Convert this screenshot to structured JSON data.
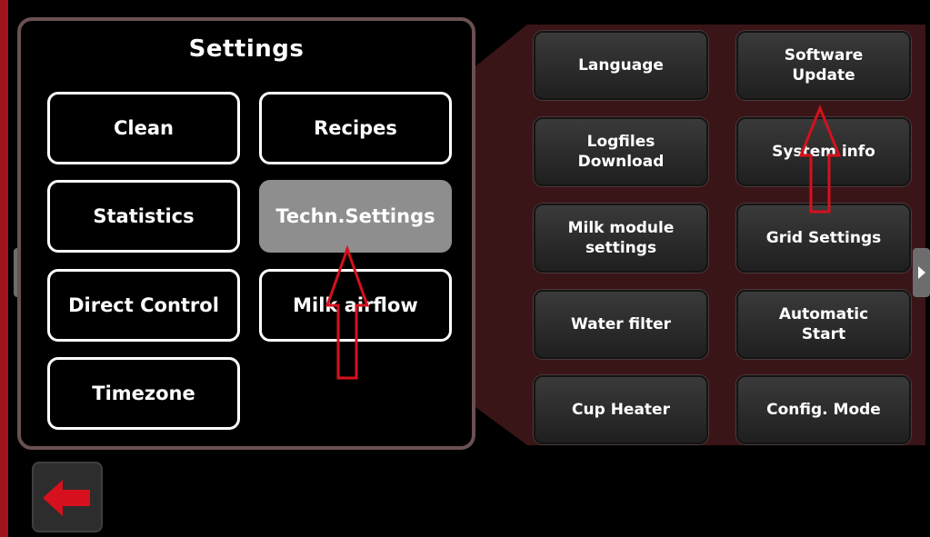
{
  "settings_panel": {
    "title": "Settings",
    "buttons": [
      {
        "label": "Clean"
      },
      {
        "label": "Recipes"
      },
      {
        "label": "Statistics"
      },
      {
        "label": "Techn.Settings",
        "selected": true
      },
      {
        "label": "Direct Control"
      },
      {
        "label": "Milk airflow"
      },
      {
        "label": "Timezone"
      }
    ]
  },
  "tech_panel": {
    "buttons": [
      {
        "lines": [
          "Language"
        ]
      },
      {
        "lines": [
          "Software",
          "Update"
        ]
      },
      {
        "lines": [
          "Logfiles",
          "Download"
        ]
      },
      {
        "lines": [
          "System info"
        ]
      },
      {
        "lines": [
          "Milk module",
          "settings"
        ]
      },
      {
        "lines": [
          "Grid Settings"
        ]
      },
      {
        "lines": [
          "Water filter"
        ]
      },
      {
        "lines": [
          "Automatic",
          "Start"
        ]
      },
      {
        "lines": [
          "Cup Heater"
        ]
      },
      {
        "lines": [
          "Config. Mode"
        ]
      }
    ]
  },
  "icons": {
    "back": "back-arrow-icon",
    "scroll_left": "chevron-left-icon",
    "scroll_right": "chevron-right-icon"
  },
  "colors": {
    "background": "#000000",
    "accent_red": "#d7101d",
    "panel_border": "#6b5052",
    "submenu_panel": "#3a1517",
    "selected_button": "#8e8e8e"
  }
}
